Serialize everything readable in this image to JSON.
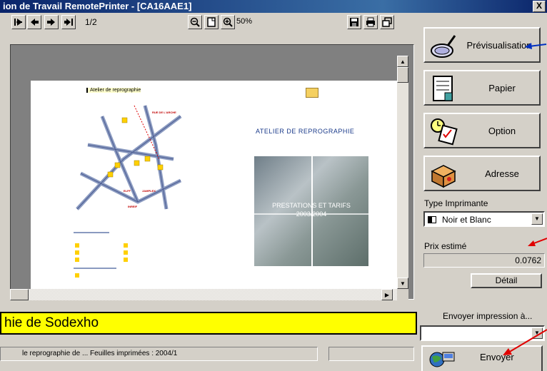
{
  "window": {
    "title": "ion de Travail RemotePrinter - [CA16AAE1]",
    "close_label": "X"
  },
  "toolbar": {
    "page_indicator": "1/2",
    "zoom_level": "50%"
  },
  "preview_page": {
    "map_label": "Atelier de reprographie",
    "heading": "ATELIER DE REPROGRAPHIE",
    "photo_caption_line1": "PRESTATIONS ET TARIFS",
    "photo_caption_line2": "2003/2004",
    "map_street_labels": [
      "RUE DE L'ARCHE",
      "ELFF",
      "JAMPLEX",
      "INREIF"
    ]
  },
  "side_panel": {
    "preview_button": "Prévisualisation",
    "paper_button": "Papier",
    "option_button": "Option",
    "address_button": "Adresse",
    "printer_type_label": "Type Imprimante",
    "printer_type_value": "Noir et Blanc",
    "price_label": "Prix estimé",
    "price_value": "0.0762",
    "detail_button": "Détail",
    "send_to_label": "Envoyer impression à...",
    "send_button": "Envoyer"
  },
  "banner": {
    "text": "hie de Sodexho"
  },
  "status_bar": {
    "text": "le reprographie de ... Feuilles imprimées : 2004/1"
  },
  "colors": {
    "title_bar": "#0a246a",
    "banner_bg": "#ffff00",
    "annotation_arrow": "#e00000",
    "annotation_arrow_blue": "#0030c0",
    "panel_bg": "#d4d0c8"
  }
}
